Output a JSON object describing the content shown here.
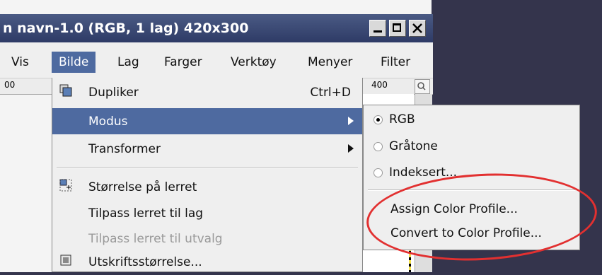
{
  "window": {
    "title": "n navn-1.0 (RGB, 1 lag) 420x300"
  },
  "menubar": {
    "items": [
      {
        "label": "Vis"
      },
      {
        "label": "Bilde"
      },
      {
        "label": "Lag"
      },
      {
        "label": "Farger"
      },
      {
        "label": "Verktøy"
      },
      {
        "label": "Menyer"
      },
      {
        "label": "Filter"
      }
    ]
  },
  "ruler": {
    "left_label": "00",
    "right_label": "400"
  },
  "bilde_menu": {
    "items": [
      {
        "label": "Dupliker",
        "accel": "Ctrl+D"
      },
      {
        "label": "Modus"
      },
      {
        "label": "Transformer"
      },
      {
        "label": "Størrelse på lerret"
      },
      {
        "label": "Tilpass lerret til lag"
      },
      {
        "label": "Tilpass lerret til utvalg"
      },
      {
        "label": "Utskriftsstørrelse..."
      }
    ]
  },
  "modus_submenu": {
    "items": [
      {
        "label": "RGB",
        "selected": true
      },
      {
        "label": "Gråtone",
        "selected": false
      },
      {
        "label": "Indeksert...",
        "selected": false
      },
      {
        "label": "Assign Color Profile..."
      },
      {
        "label": "Convert to Color Profile..."
      }
    ]
  },
  "colors": {
    "highlight": "#4e6aa0",
    "annotation": "#e23030",
    "titlebar": "#3a4873"
  }
}
